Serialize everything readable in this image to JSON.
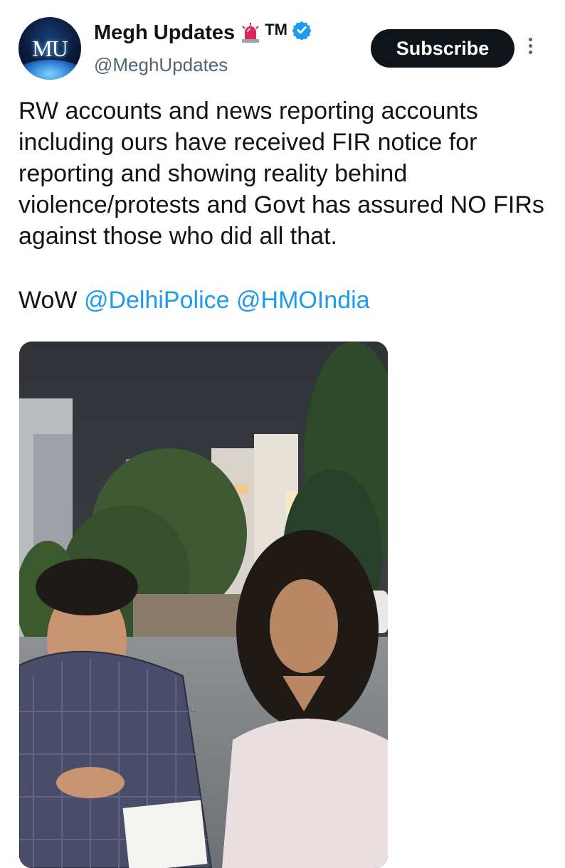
{
  "tweet": {
    "author": {
      "avatar_initials": "MU",
      "display_name": "Megh Updates",
      "badge_emoji": "siren-icon",
      "trademark": "TM",
      "verified": true,
      "handle": "@MeghUpdates"
    },
    "subscribe_label": "Subscribe",
    "body_text": "RW accounts and news reporting accounts including ours have received FIR notice for reporting and showing reality behind violence/protests and Govt has assured NO FIRs against those who did all that.",
    "closing": {
      "prefix": "WoW",
      "mentions": [
        "@DelhiPolice",
        "@HMOIndia"
      ]
    },
    "media": {
      "type": "video-thumbnail"
    }
  },
  "colors": {
    "text_primary": "#0f1419",
    "text_secondary": "#536471",
    "link": "#1d9bf0",
    "button_bg": "#0f1419",
    "verified": "#1d9bf0",
    "siren": "#e0245e"
  }
}
